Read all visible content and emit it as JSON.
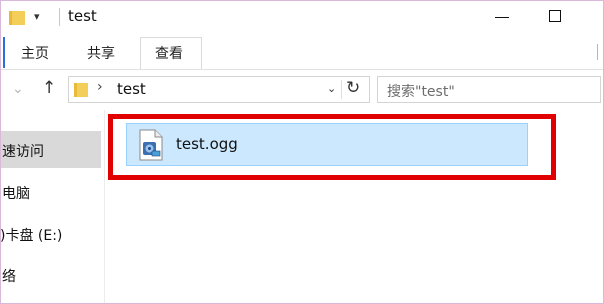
{
  "window": {
    "title": "test",
    "quick_access_arrow": "▾"
  },
  "ribbon": {
    "tabs": [
      {
        "label": "主页"
      },
      {
        "label": "共享"
      },
      {
        "label": "查看"
      }
    ]
  },
  "address_bar": {
    "path_separator": "›",
    "current_folder": "test",
    "search_placeholder": "搜索\"test\""
  },
  "nav_pane": {
    "items": [
      {
        "label": "速访问",
        "selected": true
      },
      {
        "label": "电脑"
      },
      {
        "label": ")卡盘 (E:)"
      },
      {
        "label": "络"
      }
    ]
  },
  "content": {
    "files": [
      {
        "name": "test.ogg",
        "icon": "audio-file-icon",
        "selected": true
      }
    ]
  },
  "colors": {
    "selection_fill": "#cce8ff",
    "selection_border": "#99d1ff",
    "highlight_annotation": "#e00000",
    "folder_yellow": "#f0c84a"
  }
}
